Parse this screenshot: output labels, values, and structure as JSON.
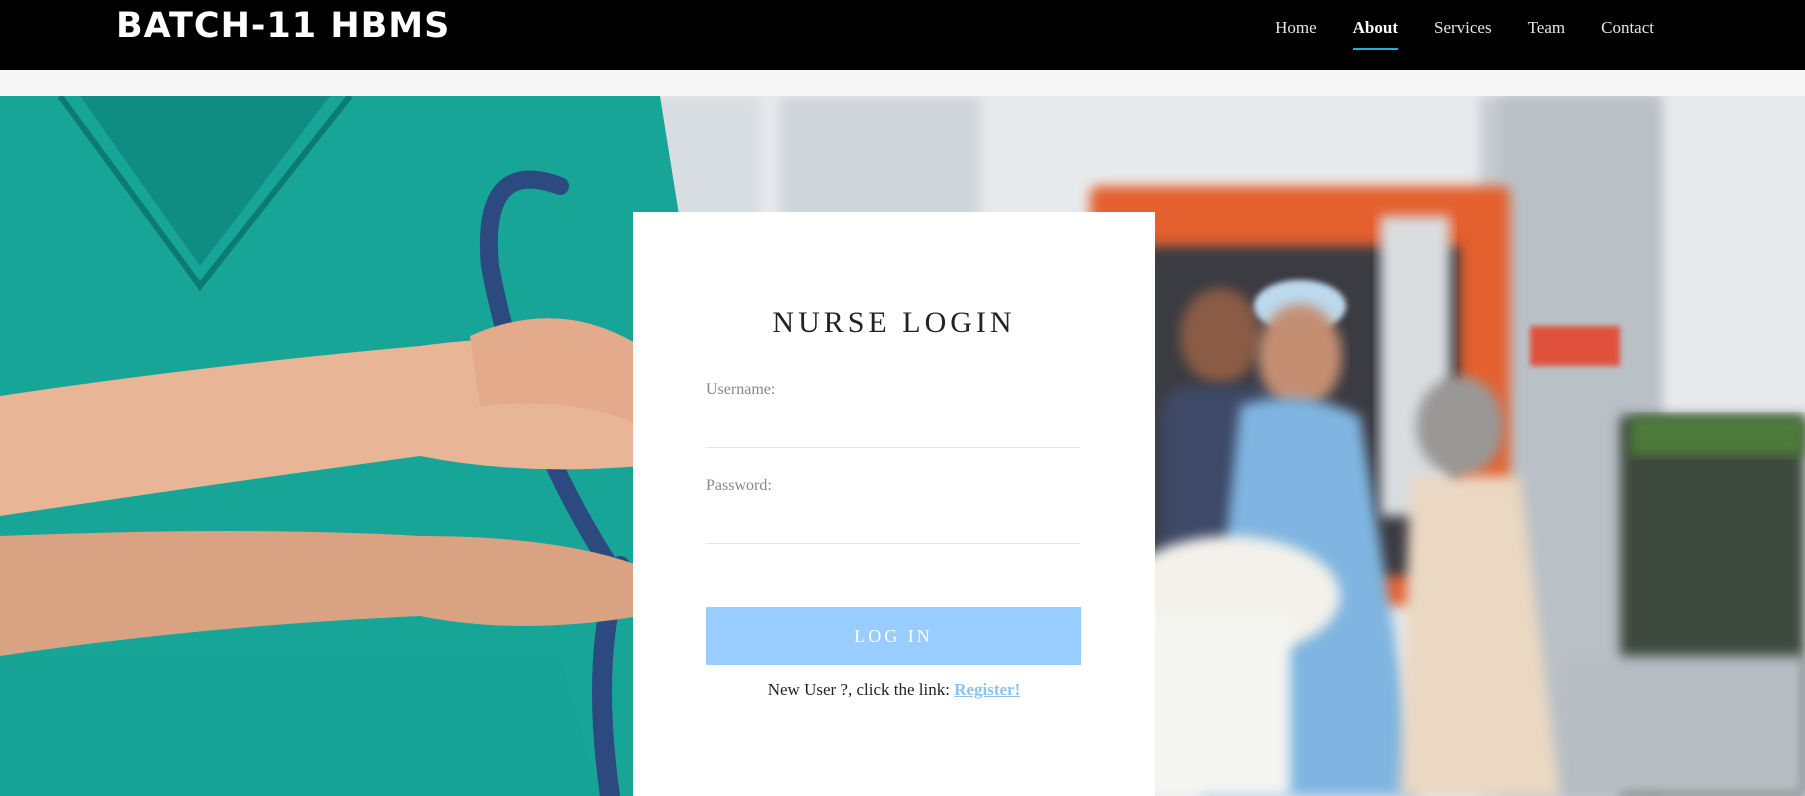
{
  "navbar": {
    "brand": "BATCH-11 HBMS",
    "items": [
      {
        "label": "Home",
        "active": false
      },
      {
        "label": "About",
        "active": true
      },
      {
        "label": "Services",
        "active": false
      },
      {
        "label": "Team",
        "active": false
      },
      {
        "label": "Contact",
        "active": false
      }
    ]
  },
  "login": {
    "title": "NURSE LOGIN",
    "username_label": "Username:",
    "username_value": "",
    "password_label": "Password:",
    "password_value": "",
    "button_label": "LOG IN",
    "register_prompt": "New User ?, click the link: ",
    "register_link": "Register!"
  },
  "colors": {
    "navbar_bg": "#000000",
    "active_underline": "#18b1e0",
    "button_bg": "#99ccff",
    "link": "#8cc2f0"
  }
}
